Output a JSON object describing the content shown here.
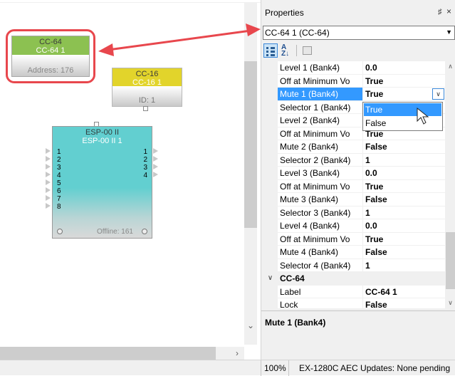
{
  "canvas": {
    "blocks": {
      "cc64": {
        "line1": "CC-64",
        "line2": "CC-64 1",
        "footer": "Address: 176",
        "color": "#8cc151"
      },
      "cc16": {
        "line1": "CC-16",
        "line2": "CC-16 1",
        "footer": "ID: 1",
        "color": "#e2d42b"
      },
      "esp": {
        "line1": "ESP-00 II",
        "line2": "ESP-00 II 1",
        "inputs": [
          "1",
          "2",
          "3",
          "4",
          "5",
          "6",
          "7",
          "8"
        ],
        "outputs": [
          "1",
          "2",
          "3",
          "4"
        ],
        "status": "Offline: 161",
        "color": "#62cfd0"
      }
    },
    "highlight_color": "#e8474d"
  },
  "properties": {
    "title": "Properties",
    "selected_object": "CC-64 1 (CC-64)",
    "rows": [
      {
        "name": "Level 1 (Bank4)",
        "value": "0.0"
      },
      {
        "name": "Off at Minimum Vo",
        "value": "True"
      },
      {
        "name": "Mute 1 (Bank4)",
        "value": "True",
        "selected": true
      },
      {
        "name": "Selector 1 (Bank4)",
        "value": "1"
      },
      {
        "name": "Level 2 (Bank4)",
        "value": "0.0"
      },
      {
        "name": "Off at Minimum Vo",
        "value": "True"
      },
      {
        "name": "Mute 2 (Bank4)",
        "value": "False"
      },
      {
        "name": "Selector 2 (Bank4)",
        "value": "1"
      },
      {
        "name": "Level 3 (Bank4)",
        "value": "0.0"
      },
      {
        "name": "Off at Minimum Vo",
        "value": "True"
      },
      {
        "name": "Mute 3 (Bank4)",
        "value": "False"
      },
      {
        "name": "Selector 3 (Bank4)",
        "value": "1"
      },
      {
        "name": "Level 4 (Bank4)",
        "value": "0.0"
      },
      {
        "name": "Off at Minimum Vo",
        "value": "True"
      },
      {
        "name": "Mute 4 (Bank4)",
        "value": "False"
      },
      {
        "name": "Selector 4 (Bank4)",
        "value": "1"
      }
    ],
    "category": "CC-64",
    "category_rows": [
      {
        "name": "Label",
        "value": "CC-64 1"
      },
      {
        "name": "Lock",
        "value": "False"
      }
    ],
    "dropdown_options": [
      "True",
      "False"
    ],
    "dropdown_highlighted": "True",
    "description_title": "Mute 1 (Bank4)",
    "selection_color": "#3399ff"
  },
  "statusbar": {
    "zoom": "100%",
    "message": "EX-1280C AEC Updates: None pending"
  }
}
